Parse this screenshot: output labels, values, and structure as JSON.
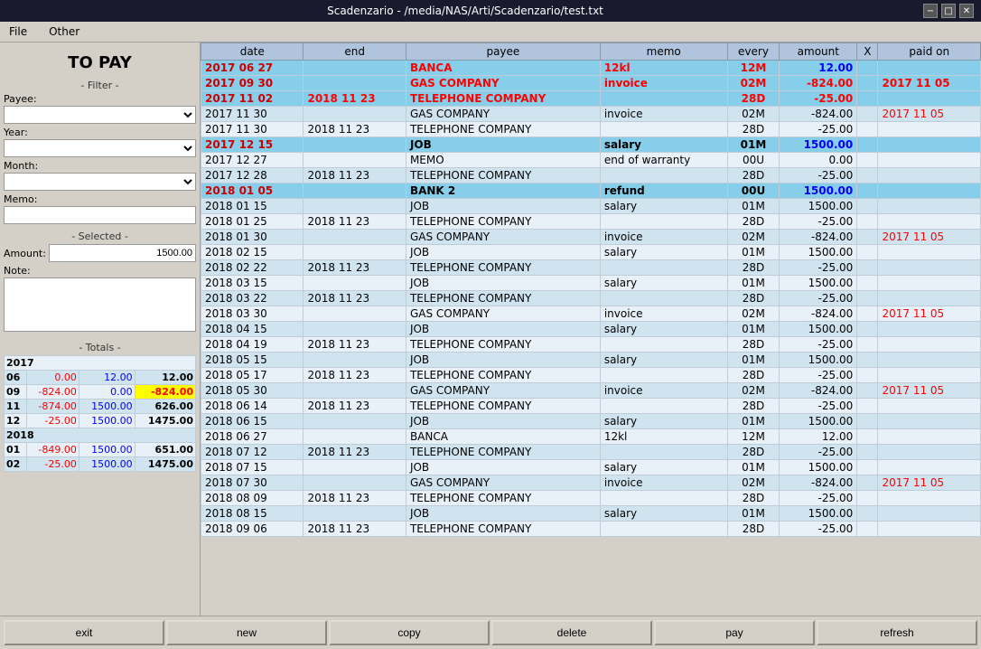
{
  "titlebar": {
    "title": "Scadenzario - /media/NAS/Arti/Scadenzario/test.txt",
    "minimize": "−",
    "maximize": "□",
    "close": "✕"
  },
  "menubar": {
    "items": [
      "File",
      "Other"
    ]
  },
  "left_panel": {
    "title": "TO PAY",
    "filter_label": "- Filter -",
    "payee_label": "Payee:",
    "year_label": "Year:",
    "month_label": "Month:",
    "memo_label": "Memo:",
    "selected_label": "- Selected -",
    "amount_label": "Amount:",
    "amount_value": "1500.00",
    "note_label": "Note:",
    "totals_label": "- Totals -"
  },
  "totals": {
    "years": [
      {
        "year": "2017",
        "rows": [
          {
            "month": "06",
            "col1": "0.00",
            "col2": "12.00",
            "col3": "12.00",
            "col1_class": "col-red",
            "col2_class": "col-blue",
            "col3_class": "col-bold"
          },
          {
            "month": "09",
            "col1": "-824.00",
            "col2": "0.00",
            "col3": "-824.00",
            "col1_class": "col-red",
            "col2_class": "col-blue",
            "col3_class": "col-yellow-bg"
          },
          {
            "month": "11",
            "col1": "-874.00",
            "col2": "1500.00",
            "col3": "626.00",
            "col1_class": "col-red",
            "col2_class": "col-blue",
            "col3_class": "col-bold"
          },
          {
            "month": "12",
            "col1": "-25.00",
            "col2": "1500.00",
            "col3": "1475.00",
            "col1_class": "col-red",
            "col2_class": "col-blue",
            "col3_class": "col-bold"
          }
        ]
      },
      {
        "year": "2018",
        "rows": [
          {
            "month": "01",
            "col1": "-849.00",
            "col2": "1500.00",
            "col3": "651.00",
            "col1_class": "col-red",
            "col2_class": "col-blue",
            "col3_class": "col-bold"
          },
          {
            "month": "02",
            "col1": "-25.00",
            "col2": "1500.00",
            "col3": "1475.00",
            "col1_class": "col-red",
            "col2_class": "col-blue",
            "col3_class": "col-bold"
          }
        ]
      }
    ]
  },
  "table": {
    "headers": [
      "date",
      "end",
      "payee",
      "memo",
      "every",
      "amount",
      "X",
      "paid on"
    ],
    "rows": [
      {
        "date": "2017 06 27",
        "end": "",
        "payee": "BANCA",
        "memo": "12kl",
        "every": "12M",
        "amount": "12.00",
        "x": "",
        "paid_on": "",
        "highlight": true,
        "payee_red": true,
        "memo_red": true,
        "every_red": true,
        "amount_blue": true
      },
      {
        "date": "2017 09 30",
        "end": "",
        "payee": "GAS COMPANY",
        "memo": "invoice",
        "every": "02M",
        "amount": "-824.00",
        "x": "",
        "paid_on": "2017 11 05",
        "highlight": true,
        "payee_red": true,
        "memo_red": true,
        "every_red": true,
        "amount_red": true,
        "paid_red": true
      },
      {
        "date": "2017 11 02",
        "end": "2018 11 23",
        "payee": "TELEPHONE COMPANY",
        "memo": "",
        "every": "28D",
        "amount": "-25.00",
        "x": "",
        "paid_on": "",
        "highlight": true,
        "payee_red": true,
        "end_red": true,
        "every_red": true,
        "amount_red": true
      },
      {
        "date": "2017 11 30",
        "end": "",
        "payee": "GAS COMPANY",
        "memo": "invoice",
        "every": "02M",
        "amount": "-824.00",
        "x": "",
        "paid_on": "2017 11 05",
        "paid_red": true
      },
      {
        "date": "2017 11 30",
        "end": "2018 11 23",
        "payee": "TELEPHONE COMPANY",
        "memo": "",
        "every": "28D",
        "amount": "-25.00",
        "x": "",
        "paid_on": ""
      },
      {
        "date": "2017 12 15",
        "end": "",
        "payee": "JOB",
        "memo": "salary",
        "every": "01M",
        "amount": "1500.00",
        "x": "",
        "paid_on": "",
        "highlight": true,
        "amount_blue": true
      },
      {
        "date": "2017 12 27",
        "end": "",
        "payee": "MEMO",
        "memo": "end of warranty",
        "every": "00U",
        "amount": "0.00",
        "x": "",
        "paid_on": ""
      },
      {
        "date": "2017 12 28",
        "end": "2018 11 23",
        "payee": "TELEPHONE COMPANY",
        "memo": "",
        "every": "28D",
        "amount": "-25.00",
        "x": "",
        "paid_on": ""
      },
      {
        "date": "2018 01 05",
        "end": "",
        "payee": "BANK 2",
        "memo": "refund",
        "every": "00U",
        "amount": "1500.00",
        "x": "",
        "paid_on": "",
        "highlight": true,
        "amount_blue": true
      },
      {
        "date": "2018 01 15",
        "end": "",
        "payee": "JOB",
        "memo": "salary",
        "every": "01M",
        "amount": "1500.00",
        "x": "",
        "paid_on": ""
      },
      {
        "date": "2018 01 25",
        "end": "2018 11 23",
        "payee": "TELEPHONE COMPANY",
        "memo": "",
        "every": "28D",
        "amount": "-25.00",
        "x": "",
        "paid_on": ""
      },
      {
        "date": "2018 01 30",
        "end": "",
        "payee": "GAS COMPANY",
        "memo": "invoice",
        "every": "02M",
        "amount": "-824.00",
        "x": "",
        "paid_on": "2017 11 05",
        "paid_red": true
      },
      {
        "date": "2018 02 15",
        "end": "",
        "payee": "JOB",
        "memo": "salary",
        "every": "01M",
        "amount": "1500.00",
        "x": "",
        "paid_on": ""
      },
      {
        "date": "2018 02 22",
        "end": "2018 11 23",
        "payee": "TELEPHONE COMPANY",
        "memo": "",
        "every": "28D",
        "amount": "-25.00",
        "x": "",
        "paid_on": ""
      },
      {
        "date": "2018 03 15",
        "end": "",
        "payee": "JOB",
        "memo": "salary",
        "every": "01M",
        "amount": "1500.00",
        "x": "",
        "paid_on": ""
      },
      {
        "date": "2018 03 22",
        "end": "2018 11 23",
        "payee": "TELEPHONE COMPANY",
        "memo": "",
        "every": "28D",
        "amount": "-25.00",
        "x": "",
        "paid_on": ""
      },
      {
        "date": "2018 03 30",
        "end": "",
        "payee": "GAS COMPANY",
        "memo": "invoice",
        "every": "02M",
        "amount": "-824.00",
        "x": "",
        "paid_on": "2017 11 05",
        "paid_red": true
      },
      {
        "date": "2018 04 15",
        "end": "",
        "payee": "JOB",
        "memo": "salary",
        "every": "01M",
        "amount": "1500.00",
        "x": "",
        "paid_on": ""
      },
      {
        "date": "2018 04 19",
        "end": "2018 11 23",
        "payee": "TELEPHONE COMPANY",
        "memo": "",
        "every": "28D",
        "amount": "-25.00",
        "x": "",
        "paid_on": ""
      },
      {
        "date": "2018 05 15",
        "end": "",
        "payee": "JOB",
        "memo": "salary",
        "every": "01M",
        "amount": "1500.00",
        "x": "",
        "paid_on": ""
      },
      {
        "date": "2018 05 17",
        "end": "2018 11 23",
        "payee": "TELEPHONE COMPANY",
        "memo": "",
        "every": "28D",
        "amount": "-25.00",
        "x": "",
        "paid_on": ""
      },
      {
        "date": "2018 05 30",
        "end": "",
        "payee": "GAS COMPANY",
        "memo": "invoice",
        "every": "02M",
        "amount": "-824.00",
        "x": "",
        "paid_on": "2017 11 05",
        "paid_red": true
      },
      {
        "date": "2018 06 14",
        "end": "2018 11 23",
        "payee": "TELEPHONE COMPANY",
        "memo": "",
        "every": "28D",
        "amount": "-25.00",
        "x": "",
        "paid_on": ""
      },
      {
        "date": "2018 06 15",
        "end": "",
        "payee": "JOB",
        "memo": "salary",
        "every": "01M",
        "amount": "1500.00",
        "x": "",
        "paid_on": ""
      },
      {
        "date": "2018 06 27",
        "end": "",
        "payee": "BANCA",
        "memo": "12kl",
        "every": "12M",
        "amount": "12.00",
        "x": "",
        "paid_on": ""
      },
      {
        "date": "2018 07 12",
        "end": "2018 11 23",
        "payee": "TELEPHONE COMPANY",
        "memo": "",
        "every": "28D",
        "amount": "-25.00",
        "x": "",
        "paid_on": ""
      },
      {
        "date": "2018 07 15",
        "end": "",
        "payee": "JOB",
        "memo": "salary",
        "every": "01M",
        "amount": "1500.00",
        "x": "",
        "paid_on": ""
      },
      {
        "date": "2018 07 30",
        "end": "",
        "payee": "GAS COMPANY",
        "memo": "invoice",
        "every": "02M",
        "amount": "-824.00",
        "x": "",
        "paid_on": "2017 11 05",
        "paid_red": true
      },
      {
        "date": "2018 08 09",
        "end": "2018 11 23",
        "payee": "TELEPHONE COMPANY",
        "memo": "",
        "every": "28D",
        "amount": "-25.00",
        "x": "",
        "paid_on": ""
      },
      {
        "date": "2018 08 15",
        "end": "",
        "payee": "JOB",
        "memo": "salary",
        "every": "01M",
        "amount": "1500.00",
        "x": "",
        "paid_on": ""
      },
      {
        "date": "2018 09 06",
        "end": "2018 11 23",
        "payee": "TELEPHONE COMPANY",
        "memo": "",
        "every": "28D",
        "amount": "-25.00",
        "x": "",
        "paid_on": ""
      }
    ]
  },
  "toolbar": {
    "exit": "exit",
    "new": "new",
    "copy": "copy",
    "delete": "delete",
    "pay": "pay",
    "refresh": "refresh"
  }
}
